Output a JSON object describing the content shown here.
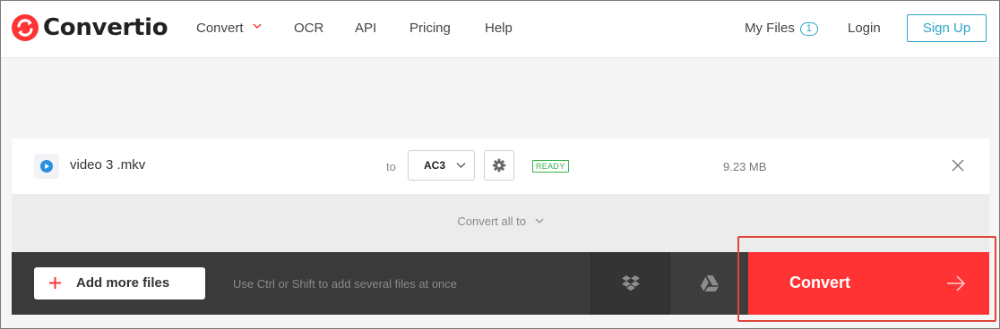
{
  "header": {
    "logo_text": "Convertio",
    "nav": {
      "convert": "Convert",
      "ocr": "OCR",
      "api": "API",
      "pricing": "Pricing",
      "help": "Help"
    },
    "my_files_label": "My Files",
    "my_files_count": "1",
    "login_label": "Login",
    "signup_label": "Sign Up"
  },
  "file": {
    "name": "video 3 .mkv",
    "to_label": "to",
    "target_format": "AC3",
    "status": "READY",
    "size": "9.23 MB"
  },
  "convert_all_label": "Convert all to",
  "bottom": {
    "add_files_label": "Add more files",
    "hint": "Use Ctrl or Shift to add several files at once",
    "convert_label": "Convert"
  },
  "colors": {
    "brand_red": "#ff3333",
    "accent_blue": "#2ea3c9",
    "ready_green": "#36b24a",
    "bar_dark": "#3a3a3a"
  },
  "icons": {
    "logo": "convertio-logo-icon",
    "file_type": "play-icon",
    "settings": "gear-icon",
    "remove": "close-icon",
    "add": "plus-icon",
    "dropbox": "dropbox-icon",
    "google_drive": "google-drive-icon",
    "convert_arrow": "arrow-right-icon"
  }
}
